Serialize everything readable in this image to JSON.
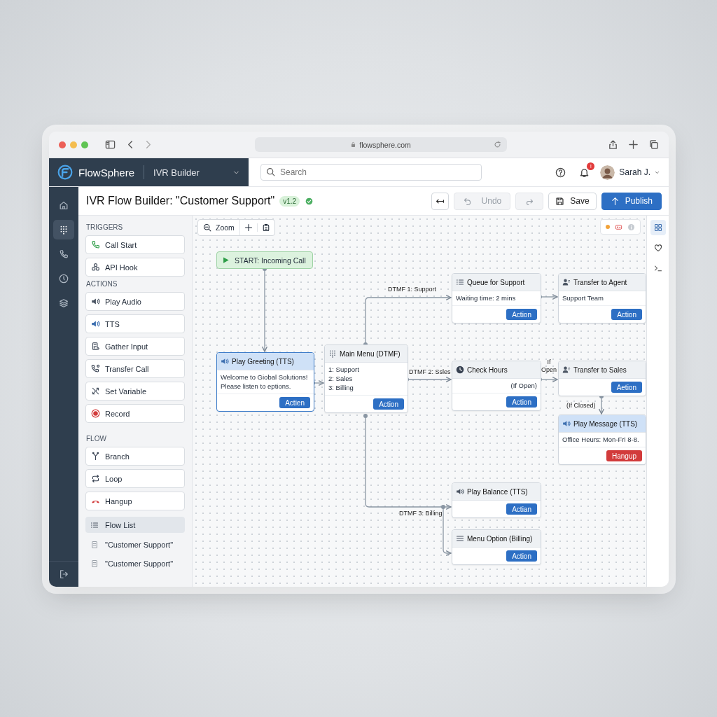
{
  "browser": {
    "address": "flowsphere.com"
  },
  "app": {
    "brand": "FlowSphere",
    "module": "IVR Builder",
    "search": {
      "placeholder": "Search"
    },
    "notification_badge": "!",
    "user": "Sarah J."
  },
  "rail": [
    {
      "selected": false
    },
    {
      "selected": true
    },
    {
      "selected": false
    },
    {
      "selected": false
    },
    {
      "selected": false
    }
  ],
  "title": {
    "text": "IVR Flow Builder: \"Customer Support\"",
    "version": "v1.2"
  },
  "actions": [
    {
      "kind": "back",
      "disabled": false
    },
    {
      "kind": "undo",
      "label": "Undo",
      "disabled": true
    },
    {
      "kind": "redo",
      "disabled": true
    },
    {
      "kind": "save",
      "label": "Save",
      "disabled": false
    },
    {
      "kind": "publish",
      "label": "Publish",
      "disabled": false
    }
  ],
  "palette": [
    {
      "heading": "TRIGGERS",
      "items": [
        "Call Start",
        "API Hook"
      ]
    },
    {
      "heading": "ACTIONS",
      "items": [
        "Play Audio",
        "TTS",
        "Gather Input",
        "Transfer Call",
        "Set Variable",
        "Record"
      ]
    },
    {
      "heading": "FLOW",
      "items": [
        "Branch",
        "Loop",
        "Hangup"
      ]
    }
  ],
  "flow_list": {
    "label": "Flow List",
    "selected": true,
    "items": [
      "\"Customer Support\"",
      "\"Customer Support\""
    ]
  },
  "canvas": {
    "zoom_label": "Zoom",
    "nodes": [
      {
        "kind": "start",
        "title": "START: Incoming Call"
      },
      {
        "kind": "step",
        "title": "Play Greeting (TTS)",
        "selected": true,
        "highlighted": true,
        "lines": [
          "Welcome to Giobal Solutions!",
          "Please listen to eptions."
        ],
        "button": {
          "label": "Actien",
          "kind": "action"
        }
      },
      {
        "kind": "step",
        "title": "Main Menu (DTMF)",
        "selected": false,
        "highlighted": false,
        "lines": [
          "1: Support",
          "2: Sales",
          "3: Billing"
        ],
        "button": {
          "label": "Action",
          "kind": "action"
        }
      },
      {
        "kind": "step",
        "title": "Queue for Support",
        "selected": false,
        "highlighted": false,
        "lines": [
          "Waiting time: 2 mins"
        ],
        "button": {
          "label": "Action",
          "kind": "action"
        }
      },
      {
        "kind": "step",
        "title": "Transfer to Agent",
        "selected": false,
        "highlighted": false,
        "lines": [
          "Support Team"
        ],
        "button": {
          "label": "Action",
          "kind": "action"
        }
      },
      {
        "kind": "step",
        "title": "Check Hours",
        "selected": false,
        "highlighted": false,
        "note": "(If Open)",
        "button": {
          "label": "Action",
          "kind": "action"
        }
      },
      {
        "kind": "step",
        "title": "Transfer to Sales",
        "selected": false,
        "highlighted": false,
        "button": {
          "label": "Aetion",
          "kind": "action"
        }
      },
      {
        "kind": "step",
        "title": "Play Message (TTS)",
        "selected": false,
        "highlighted": true,
        "lines": [
          "Office Heurs: Mon-Fri 8-8."
        ],
        "button": {
          "label": "Hangup",
          "kind": "hangup"
        }
      },
      {
        "kind": "step",
        "title": "Play Balance (TTS)",
        "selected": false,
        "highlighted": false,
        "button": {
          "label": "Actian",
          "kind": "action"
        }
      },
      {
        "kind": "step",
        "title": "Menu Option (Billing)",
        "selected": false,
        "highlighted": false,
        "button": {
          "label": "Action",
          "kind": "action"
        }
      }
    ],
    "edge_labels": [
      "DTMF 1: Support",
      "DTMF 2: Ssles",
      "If Open",
      "(If Closed)",
      "DTMF 3: Billing"
    ]
  },
  "right_rail": [
    {
      "selected": true
    },
    {
      "selected": false
    },
    {
      "selected": false
    }
  ]
}
